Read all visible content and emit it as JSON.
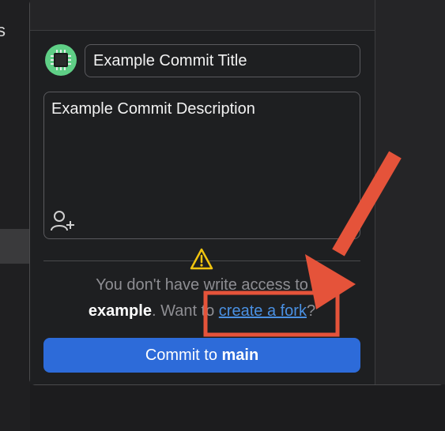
{
  "background": {
    "left_fragment_text": "s"
  },
  "commit": {
    "title_value": "Example Commit Title",
    "description_value": "Example Commit Description",
    "button_prefix": "Commit to ",
    "button_branch": "main"
  },
  "notice": {
    "line1": "You don't have write access to",
    "repo_name": "example",
    "want_prefix": ". Want to ",
    "fork_link": "create a fork",
    "suffix": "?"
  },
  "icons": {
    "avatar": "chip-avatar-icon",
    "coauthor": "add-coauthor-icon",
    "warning": "warning-triangle-icon"
  },
  "colors": {
    "accent": "#2d6bd9",
    "link": "#4a90e2",
    "annotation": "#e5533a",
    "warning": "#f1c40f"
  }
}
